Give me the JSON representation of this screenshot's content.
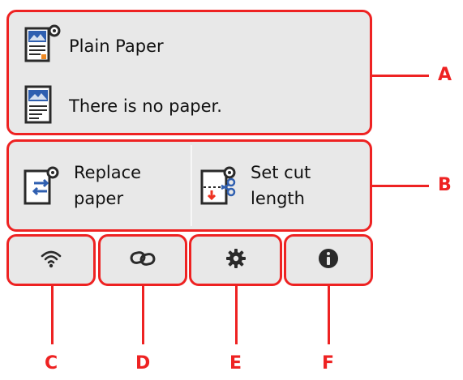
{
  "paper_info": {
    "paper_type": "Plain Paper",
    "paper_status": "There is no paper."
  },
  "actions": {
    "replace_line1": "Replace",
    "replace_line2": "paper",
    "cut_line1": "Set cut",
    "cut_line2": "length"
  },
  "bottom_buttons": [
    {
      "icon": "wifi-icon"
    },
    {
      "icon": "link-icon"
    },
    {
      "icon": "gear-icon"
    },
    {
      "icon": "info-icon"
    }
  ],
  "callouts": {
    "a": "A",
    "b": "B",
    "c": "C",
    "d": "D",
    "e": "E",
    "f": "F"
  },
  "colors": {
    "callout": "#ee2222",
    "panel_bg": "#e8e8e8",
    "icon_blue": "#2f5fb0",
    "icon_dark": "#2a2a2a",
    "icon_orange": "#f08a24"
  }
}
